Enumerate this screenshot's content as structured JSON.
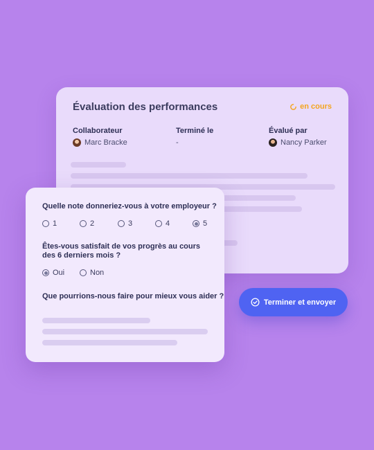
{
  "evaluation": {
    "title": "Évaluation des performances",
    "status": "en cours",
    "status_color": "#f3a51f",
    "collaborator_label": "Collaborateur",
    "collaborator_name": "Marc Bracke",
    "finished_label": "Terminé le",
    "finished_value": "-",
    "evaluator_label": "Évalué par",
    "evaluator_name": "Nancy Parker"
  },
  "form": {
    "q1": "Quelle note donneriez-vous à votre employeur ?",
    "q1_options": [
      "1",
      "2",
      "3",
      "4",
      "5"
    ],
    "q1_selected": "5",
    "q2": "Êtes-vous satisfait de vos progrès au cours des 6 derniers mois ?",
    "q2_options": [
      "Oui",
      "Non"
    ],
    "q2_selected": "Oui",
    "q3": "Que pourrions-nous faire pour mieux vous aider ?"
  },
  "submit": {
    "label": "Terminer et envoyer",
    "icon": "check-circle-icon",
    "color": "#4f63f2"
  }
}
